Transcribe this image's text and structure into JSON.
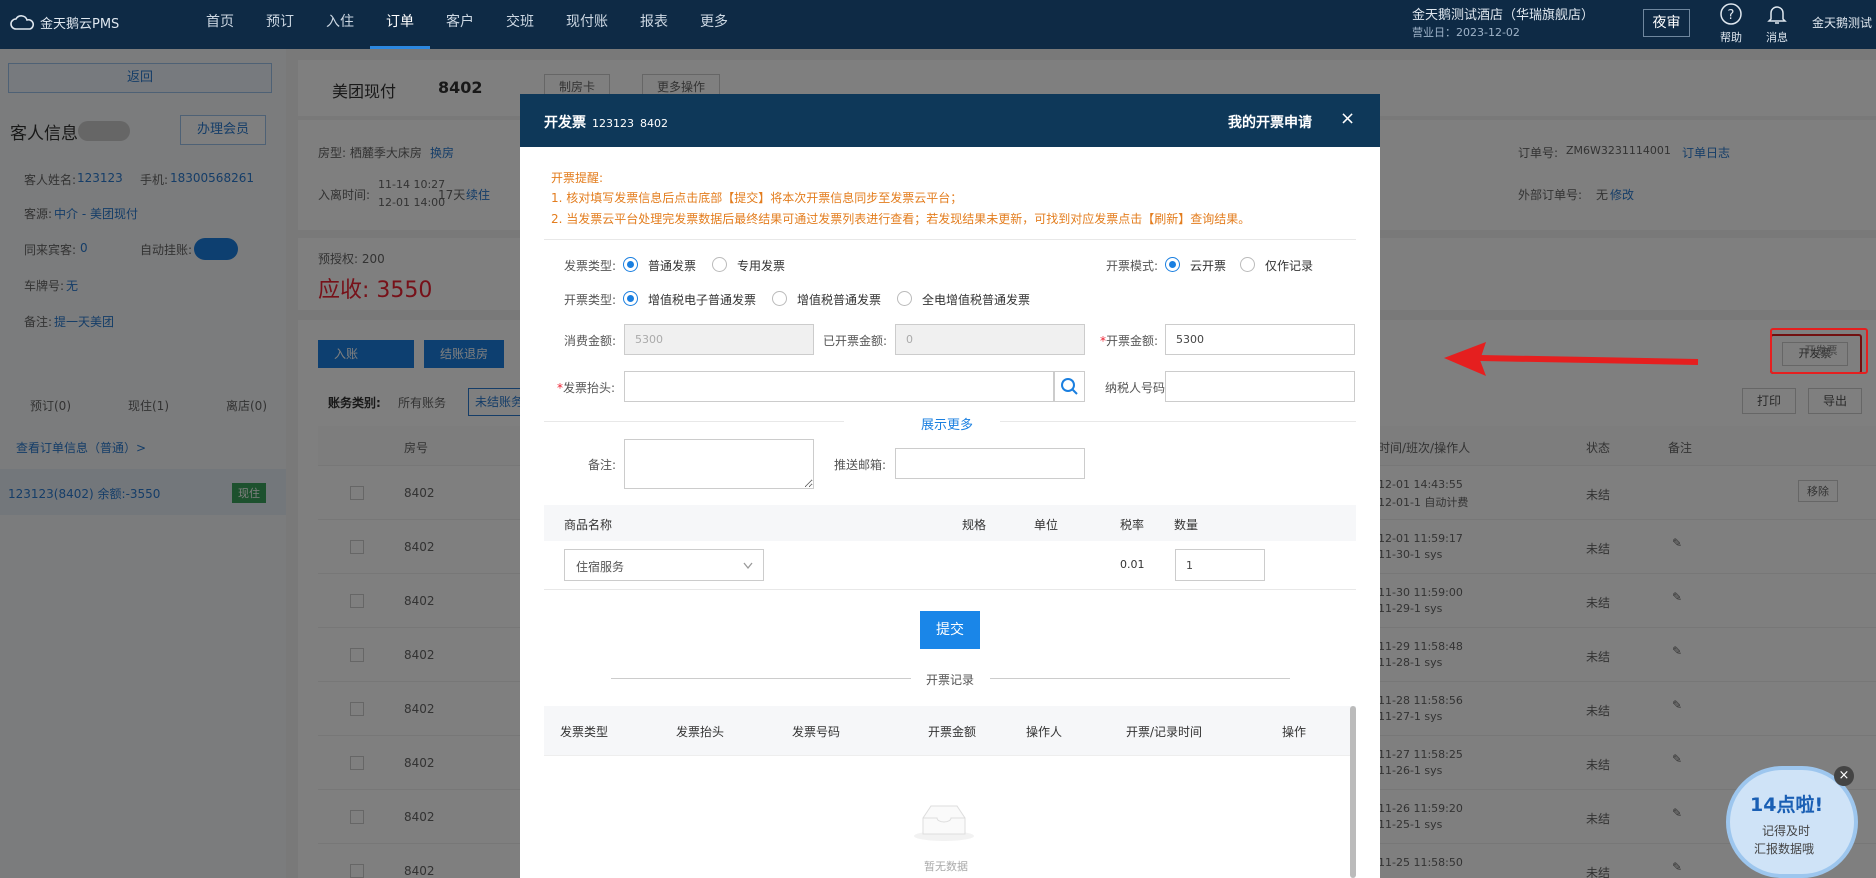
{
  "app": {
    "logo": "金天鹅云PMS"
  },
  "nav": [
    "首页",
    "预订",
    "入住",
    "订单",
    "客户",
    "交班",
    "现付账",
    "报表",
    "更多"
  ],
  "nav_active": 3,
  "header": {
    "hotel": "金天鹅测试酒店（华瑞旗舰店）",
    "business_date": "营业日：2023-12-02",
    "night_audit": "夜审",
    "help": "帮助",
    "messages": "消息",
    "user": "金天鹅测试"
  },
  "left": {
    "back": "返回",
    "guest_info": "客人信息",
    "member_btn": "办理会员",
    "guest_name_label": "客人姓名:",
    "guest_name": "123123",
    "phone_label": "手机:",
    "phone": "18300568261",
    "source_label": "客源:",
    "source": "中介 - 美团现付",
    "companion_label": "同来宾客:",
    "companion": "0",
    "auto_hang_label": "自动挂账:",
    "plate_label": "车牌号:",
    "plate": "无",
    "remark_label": "备注:",
    "remark": "提一天美团",
    "booked": "预订(0)",
    "staying": "现住(1)",
    "left_out": "离店(0)",
    "view_order": "查看订单信息（普通）>",
    "room_item": "123123(8402) 余额:-3550",
    "room_status": "现住"
  },
  "order": {
    "channel": "美团现付",
    "room": "8402",
    "make_card": "制房卡",
    "more_ops": "更多操作",
    "room_type": "房型: 栖麓季大床房",
    "change_room": "换房",
    "stay_label": "入离时间:",
    "checkin": "11-14 10:27",
    "checkout": "12-01 14:00",
    "days": "17天",
    "extend": "续住",
    "deposit": "预授权: 200",
    "receivable": "应收: 3550",
    "order_no_label": "订单号:",
    "order_no": "ZM6W3231114001",
    "order_log": "订单日志",
    "ext_order_label": "外部订单号:",
    "ext_order": "无",
    "modify": "修改",
    "post": "入账",
    "settle": "结账退房",
    "invoice_btn": "开发票",
    "print": "打印",
    "export": "导出",
    "bill_cat": "账务类别:",
    "all_bills": "所有账务",
    "unsettled": "未结账务",
    "col_room": "房号",
    "col_time": "时间/班次/操作人",
    "col_status": "状态",
    "col_remark": "备注",
    "rows": [
      {
        "room": "8402",
        "t1": "12-01 14:43:55",
        "t2": "12-01-1 自动计费",
        "status": "未结",
        "action": "移除"
      },
      {
        "room": "8402",
        "t1": "12-01 11:59:17",
        "t2": "11-30-1 sys",
        "status": "未结"
      },
      {
        "room": "8402",
        "t1": "11-30 11:59:00",
        "t2": "11-29-1 sys",
        "status": "未结"
      },
      {
        "room": "8402",
        "t1": "11-29 11:58:48",
        "t2": "11-28-1 sys",
        "status": "未结"
      },
      {
        "room": "8402",
        "t1": "11-28 11:58:56",
        "t2": "11-27-1 sys",
        "status": "未结"
      },
      {
        "room": "8402",
        "t1": "11-27 11:58:25",
        "t2": "11-26-1 sys",
        "status": "未结"
      },
      {
        "room": "8402",
        "t1": "11-26 11:59:20",
        "t2": "11-25-1 sys",
        "status": "未结"
      },
      {
        "room": "8402",
        "t1": "11-25 11:58:50",
        "t2": "",
        "status": "未结"
      }
    ]
  },
  "modal": {
    "title": "开发票",
    "sub1": "123123",
    "sub2": "8402",
    "my_requests": "我的开票申请",
    "close": "×",
    "notice_title": "开票提醒:",
    "notice1": "1. 核对填写发票信息后点击底部【提交】将本次开票信息同步至发票云平台；",
    "notice2": "2. 当发票云平台处理完发票数据后最终结果可通过发票列表进行查看；若发现结果未更新，可找到对应发票点击【刷新】查询结果。",
    "inv_kind_label": "发票类型:",
    "inv_kind_1": "普通发票",
    "inv_kind_2": "专用发票",
    "mode_label": "开票模式:",
    "mode_1": "云开票",
    "mode_2": "仅作记录",
    "inv_type_label": "开票类型:",
    "inv_type_1": "增值税电子普通发票",
    "inv_type_2": "增值税普通发票",
    "inv_type_3": "全电增值税普通发票",
    "consume_label": "消费金额:",
    "consume": "5300",
    "issued_label": "已开票金额:",
    "issued": "0",
    "amount_label": "开票金额:",
    "amount": "5300",
    "title_label": "发票抬头:",
    "tax_label": "纳税人号码:",
    "show_more": "展示更多",
    "remark_label": "备注:",
    "email_label": "推送邮箱:",
    "goods_h": [
      "商品名称",
      "规格",
      "单位",
      "税率",
      "数量"
    ],
    "goods_name": "住宿服务",
    "tax_rate": "0.01",
    "qty": "1",
    "submit": "提交",
    "records": "开票记录",
    "rec_h": [
      "发票类型",
      "发票抬头",
      "发票号码",
      "开票金额",
      "操作人",
      "开票/记录时间",
      "操作"
    ],
    "empty": "暂无数据"
  },
  "widget": {
    "time": "14点啦!",
    "line1": "记得及时",
    "line2": "汇报数据哦"
  }
}
